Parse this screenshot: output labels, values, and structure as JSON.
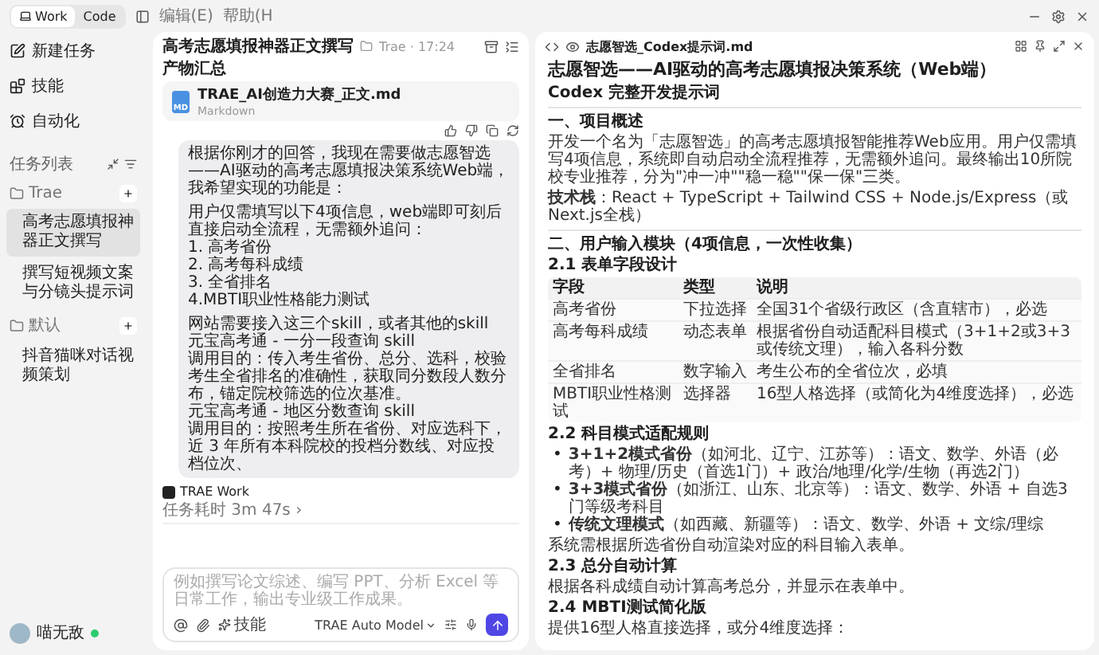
{
  "top_bar": {
    "modes": [
      {
        "label": "Work",
        "selected": true
      },
      {
        "label": "Code",
        "selected": false
      }
    ],
    "menu": [
      "编辑(E)",
      "帮助(H"
    ]
  },
  "sidebar": {
    "nav": [
      "新建任务",
      "技能",
      "自动化"
    ],
    "task_list": {
      "title": "任务列表",
      "groups": [
        {
          "name": "Trae",
          "items": [
            {
              "label": "高考志愿填报神器正文撰写",
              "selected": true
            },
            {
              "label": "撰写短视频文案与分镜头提示词",
              "selected": false
            }
          ]
        },
        {
          "name": "默认",
          "items": [
            {
              "label": "抖音猫咪对话视频策划",
              "selected": false
            }
          ]
        }
      ]
    },
    "user": {
      "name": "喵无敌",
      "online": true
    }
  },
  "chat": {
    "title": "高考志愿填报神器正文撰写",
    "meta": "Trae · 17:24",
    "section": "产物汇总",
    "file": {
      "name": "TRAE_AI创造力大赛_正文.md",
      "type": "Markdown",
      "badge": "MD"
    },
    "message": [
      "根据你刚才的回答，我现在需要做志愿智选——AI驱动的高考志愿填报决策系统Web端，我希望实现的功能是：",
      "用户仅需填写以下4项信息，web端即可刻后直接启动全流程，无需额外追问：",
      "1. 高考省份",
      "2. 高考每科成绩",
      "3. 全省排名",
      "4.MBTI职业性格能力测试",
      "网站需要接入这三个skill，或者其他的skill",
      "元宝高考通 - 一分一段查询 skill",
      "调用目的：传入考生省份、总分、选科，校验考生全省排名的准确性，获取同分数段人数分布，锚定院校筛选的位次基准。",
      "元宝高考通 - 地区分数查询 skill",
      "调用目的：按照考生所在省份、对应选科下，近 3 年所有本科院校的投档分数线、对应投档位次、"
    ],
    "agent": "TRAE Work",
    "duration": "任务耗时 3m 47s ›",
    "input": {
      "placeholder": "例如撰写论文综述、编写 PPT、分析 Excel 等日常工作，输出专业级工作成果。",
      "skill": "技能",
      "model": "TRAE Auto Model"
    }
  },
  "document": {
    "filename": "志愿智选_Codex提示词.md",
    "blocks": [
      {
        "kind": "title",
        "text": "志愿智选——AI驱动的高考志愿填报决策系统（Web端）"
      },
      {
        "kind": "subtitle",
        "text": "Codex 完整开发提示词"
      },
      {
        "kind": "rule"
      },
      {
        "kind": "heading",
        "text": "一、项目概述"
      },
      {
        "kind": "paragraph",
        "text": "开发一个名为「志愿智选」的高考志愿填报智能推荐Web应用。用户仅需填写4项信息，系统即自动启动全流程推荐，无需额外追问。最终输出10所院校专业推荐，分为\"冲一冲\"\"稳一稳\"\"保一保\"三类。"
      },
      {
        "kind": "paragraph",
        "text": "**技术栈**：React + TypeScript + Tailwind CSS + Node.js/Express（或Next.js全栈）"
      },
      {
        "kind": "rule"
      },
      {
        "kind": "heading",
        "text": "二、用户输入模块（4项信息，一次性收集）"
      },
      {
        "kind": "subheading",
        "text": "2.1 表单字段设计"
      },
      {
        "kind": "table",
        "columns": [
          "字段",
          "类型",
          "说明"
        ],
        "rows": [
          [
            "高考省份",
            "下拉选择",
            "全国31个省级行政区（含直辖市），必选"
          ],
          [
            "高考每科成绩",
            "动态表单",
            "根据省份自动适配科目模式（3+1+2或3+3或传统文理），输入各科分数"
          ],
          [
            "全省排名",
            "数字输入",
            "考生公布的全省位次，必填"
          ],
          [
            "MBTI职业性格测试",
            "选择器",
            "16型人格选择（或简化为4维度选择），必选"
          ]
        ]
      },
      {
        "kind": "subheading",
        "text": "2.2 科目模式适配规则"
      },
      {
        "kind": "bullets",
        "marker": "•",
        "items": [
          "**3+1+2模式省份**（如河北、辽宁、江苏等）：语文、数学、外语（必考）+ 物理/历史（首选1门）+ 政治/地理/化学/生物（再选2门）",
          "**3+3模式省份**（如浙江、山东、北京等）：语文、数学、外语 + 自选3门等级考科目",
          "**传统文理模式**（如西藏、新疆等）：语文、数学、外语 + 文综/理综"
        ]
      },
      {
        "kind": "paragraph",
        "text": "系统需根据所选省份自动渲染对应的科目输入表单。"
      },
      {
        "kind": "subheading",
        "text": "2.3 总分自动计算"
      },
      {
        "kind": "paragraph",
        "text": "根据各科成绩自动计算高考总分，并显示在表单中。"
      },
      {
        "kind": "subheading",
        "text": "2.4 MBTI测试简化版"
      },
      {
        "kind": "paragraph",
        "text": "提供16型人格直接选择，或分4维度选择："
      }
    ]
  }
}
